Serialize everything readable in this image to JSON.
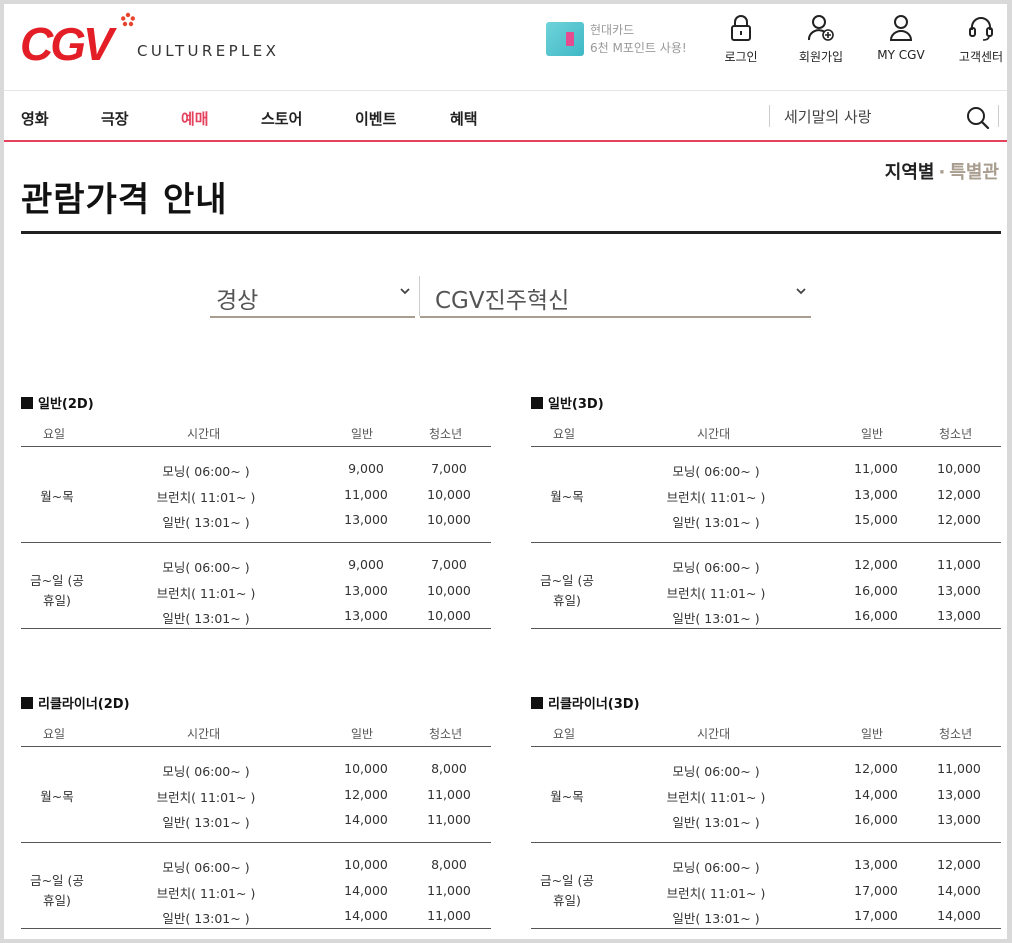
{
  "header": {
    "logo_text": "CGV",
    "tagline": "CULTUREPLEX",
    "ad": {
      "line1": "현대카드",
      "line2": "6천 M포인트 사용!"
    },
    "util": [
      {
        "label": "로그인",
        "icon": "lock-icon"
      },
      {
        "label": "회원가입",
        "icon": "user-add-icon"
      },
      {
        "label": "MY CGV",
        "icon": "user-icon"
      },
      {
        "label": "고객센터",
        "icon": "headset-icon"
      }
    ]
  },
  "nav": {
    "items": [
      "영화",
      "극장",
      "예매",
      "스토어",
      "이벤트",
      "혜택"
    ],
    "active": "예매",
    "search_value": "세기말의 사랑"
  },
  "page": {
    "title": "관람가격 안내",
    "toggle": {
      "on": "지역별",
      "sep": "·",
      "off": "특별관"
    },
    "region_select": "경상",
    "theater_select": "CGV진주혁신"
  },
  "columns": {
    "day": "요일",
    "time": "시간대",
    "general": "일반",
    "youth": "청소년"
  },
  "tables": [
    {
      "title": "일반(2D)",
      "groups": [
        {
          "day": "월~목",
          "rows": [
            {
              "time": "모닝( 06:00~ )",
              "general": "9,000",
              "youth": "7,000"
            },
            {
              "time": "브런치( 11:01~ )",
              "general": "11,000",
              "youth": "10,000"
            },
            {
              "time": "일반( 13:01~ )",
              "general": "13,000",
              "youth": "10,000"
            }
          ]
        },
        {
          "day": "금~일 (공\n휴일)",
          "rows": [
            {
              "time": "모닝( 06:00~ )",
              "general": "9,000",
              "youth": "7,000"
            },
            {
              "time": "브런치( 11:01~ )",
              "general": "13,000",
              "youth": "10,000"
            },
            {
              "time": "일반( 13:01~ )",
              "general": "13,000",
              "youth": "10,000"
            }
          ]
        }
      ]
    },
    {
      "title": "일반(3D)",
      "groups": [
        {
          "day": "월~목",
          "rows": [
            {
              "time": "모닝( 06:00~ )",
              "general": "11,000",
              "youth": "10,000"
            },
            {
              "time": "브런치( 11:01~ )",
              "general": "13,000",
              "youth": "12,000"
            },
            {
              "time": "일반( 13:01~ )",
              "general": "15,000",
              "youth": "12,000"
            }
          ]
        },
        {
          "day": "금~일 (공\n휴일)",
          "rows": [
            {
              "time": "모닝( 06:00~ )",
              "general": "12,000",
              "youth": "11,000"
            },
            {
              "time": "브런치( 11:01~ )",
              "general": "16,000",
              "youth": "13,000"
            },
            {
              "time": "일반( 13:01~ )",
              "general": "16,000",
              "youth": "13,000"
            }
          ]
        }
      ]
    },
    {
      "title": "리클라이너(2D)",
      "groups": [
        {
          "day": "월~목",
          "rows": [
            {
              "time": "모닝( 06:00~ )",
              "general": "10,000",
              "youth": "8,000"
            },
            {
              "time": "브런치( 11:01~ )",
              "general": "12,000",
              "youth": "11,000"
            },
            {
              "time": "일반( 13:01~ )",
              "general": "14,000",
              "youth": "11,000"
            }
          ]
        },
        {
          "day": "금~일 (공\n휴일)",
          "rows": [
            {
              "time": "모닝( 06:00~ )",
              "general": "10,000",
              "youth": "8,000"
            },
            {
              "time": "브런치( 11:01~ )",
              "general": "14,000",
              "youth": "11,000"
            },
            {
              "time": "일반( 13:01~ )",
              "general": "14,000",
              "youth": "11,000"
            }
          ]
        }
      ]
    },
    {
      "title": "리클라이너(3D)",
      "groups": [
        {
          "day": "월~목",
          "rows": [
            {
              "time": "모닝( 06:00~ )",
              "general": "12,000",
              "youth": "11,000"
            },
            {
              "time": "브런치( 11:01~ )",
              "general": "14,000",
              "youth": "13,000"
            },
            {
              "time": "일반( 13:01~ )",
              "general": "16,000",
              "youth": "13,000"
            }
          ]
        },
        {
          "day": "금~일 (공\n휴일)",
          "rows": [
            {
              "time": "모닝( 06:00~ )",
              "general": "13,000",
              "youth": "12,000"
            },
            {
              "time": "브런치( 11:01~ )",
              "general": "17,000",
              "youth": "14,000"
            },
            {
              "time": "일반( 13:01~ )",
              "general": "17,000",
              "youth": "14,000"
            }
          ]
        }
      ]
    }
  ],
  "colors": {
    "brand": "#e4425d",
    "accent_tan": "#a89d8e",
    "logo_red": "#e41e26"
  }
}
